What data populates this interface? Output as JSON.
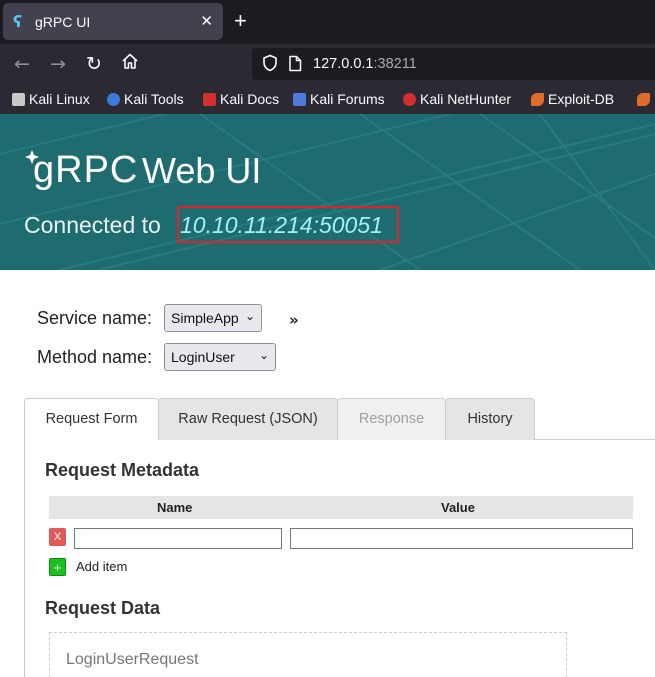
{
  "browser": {
    "tab_title": "gRPC UI",
    "tab_favicon": "ʕG",
    "new_tab": "+",
    "url_host": "127.0.0.1",
    "url_port": ":38211",
    "bookmarks": [
      {
        "label": "Kali Linux",
        "color": "#c9c9c9"
      },
      {
        "label": "Kali Tools",
        "color": "#3a7bd5"
      },
      {
        "label": "Kali Docs",
        "color": "#d32f2f"
      },
      {
        "label": "Kali Forums",
        "color": "#4c7bd9"
      },
      {
        "label": "Kali NetHunter",
        "color": "#d32f2f"
      },
      {
        "label": "Exploit-DB",
        "color": "#e06b2b"
      }
    ]
  },
  "header": {
    "logo": "gRPC",
    "title": "Web UI",
    "connected_label": "Connected to",
    "address": "10.10.11.214:50051",
    "bg_color": "#1e6c6f",
    "highlight_color": "#e0202a"
  },
  "form": {
    "service_label": "Service name:",
    "service_value": "SimpleApp",
    "method_label": "Method name:",
    "method_value": "LoginUser",
    "expand_icon": "»"
  },
  "tabs": [
    {
      "label": "Request Form",
      "state": "active"
    },
    {
      "label": "Raw Request (JSON)",
      "state": "normal"
    },
    {
      "label": "Response",
      "state": "disabled"
    },
    {
      "label": "History",
      "state": "normal"
    }
  ],
  "metadata": {
    "title": "Request Metadata",
    "col_name": "Name",
    "col_value": "Value",
    "remove_label": "X",
    "add_symbol": "+",
    "add_label": "Add item"
  },
  "request_data": {
    "title": "Request Data",
    "message_name": "LoginUserRequest"
  }
}
